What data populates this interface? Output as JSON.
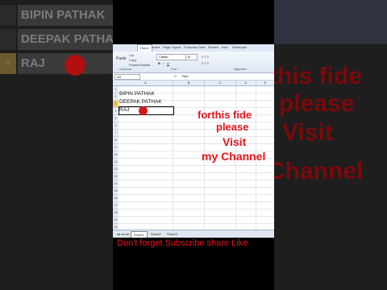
{
  "background_left": {
    "rows": [
      {
        "num": "",
        "text": "BIPIN PATHAK"
      },
      {
        "num": "",
        "text": "DEEPAK PATHAK"
      },
      {
        "num": "4",
        "text": "RAJ"
      }
    ]
  },
  "background_right": {
    "lines": [
      "this fide",
      "please",
      "Visit",
      "Channel"
    ]
  },
  "ribbon": {
    "tabs": [
      "Home",
      "Insert",
      "Page Layout",
      "Formulas",
      "Data",
      "Review",
      "View",
      "Developer"
    ],
    "active_tab": "Home",
    "clipboard": [
      "Cut",
      "Copy",
      "Format Painter"
    ],
    "paste_label": "Paste",
    "font_name": "Calibri",
    "font_size": "11",
    "groups": [
      "Clipboard",
      "Font",
      "Alignment"
    ]
  },
  "formula_bar": {
    "name_box": "A3",
    "fx": "fx",
    "value": "RAJ"
  },
  "columns": [
    "A",
    "B",
    "C",
    "D",
    "E"
  ],
  "cells": [
    "BIPIN PATHAK",
    "DEEPAK PATHAK",
    "RAJ"
  ],
  "row_numbers": [
    "1",
    "2",
    "3",
    "4",
    "5",
    "6",
    "7",
    "8",
    "9",
    "10",
    "11",
    "12",
    "13",
    "14",
    "15",
    "16",
    "17",
    "18",
    "19",
    "20",
    "21"
  ],
  "sheets": [
    "Sheet1",
    "Sheet2",
    "Sheet3"
  ],
  "overlay": {
    "line1": "forthis fide",
    "line2": "please",
    "line3": "Visit",
    "line4": "my Channel",
    "bottom": "Don't forget Subscribe share Like"
  },
  "colors": {
    "overlay_red": "#e8141c",
    "selection_dot": "#d81818"
  }
}
